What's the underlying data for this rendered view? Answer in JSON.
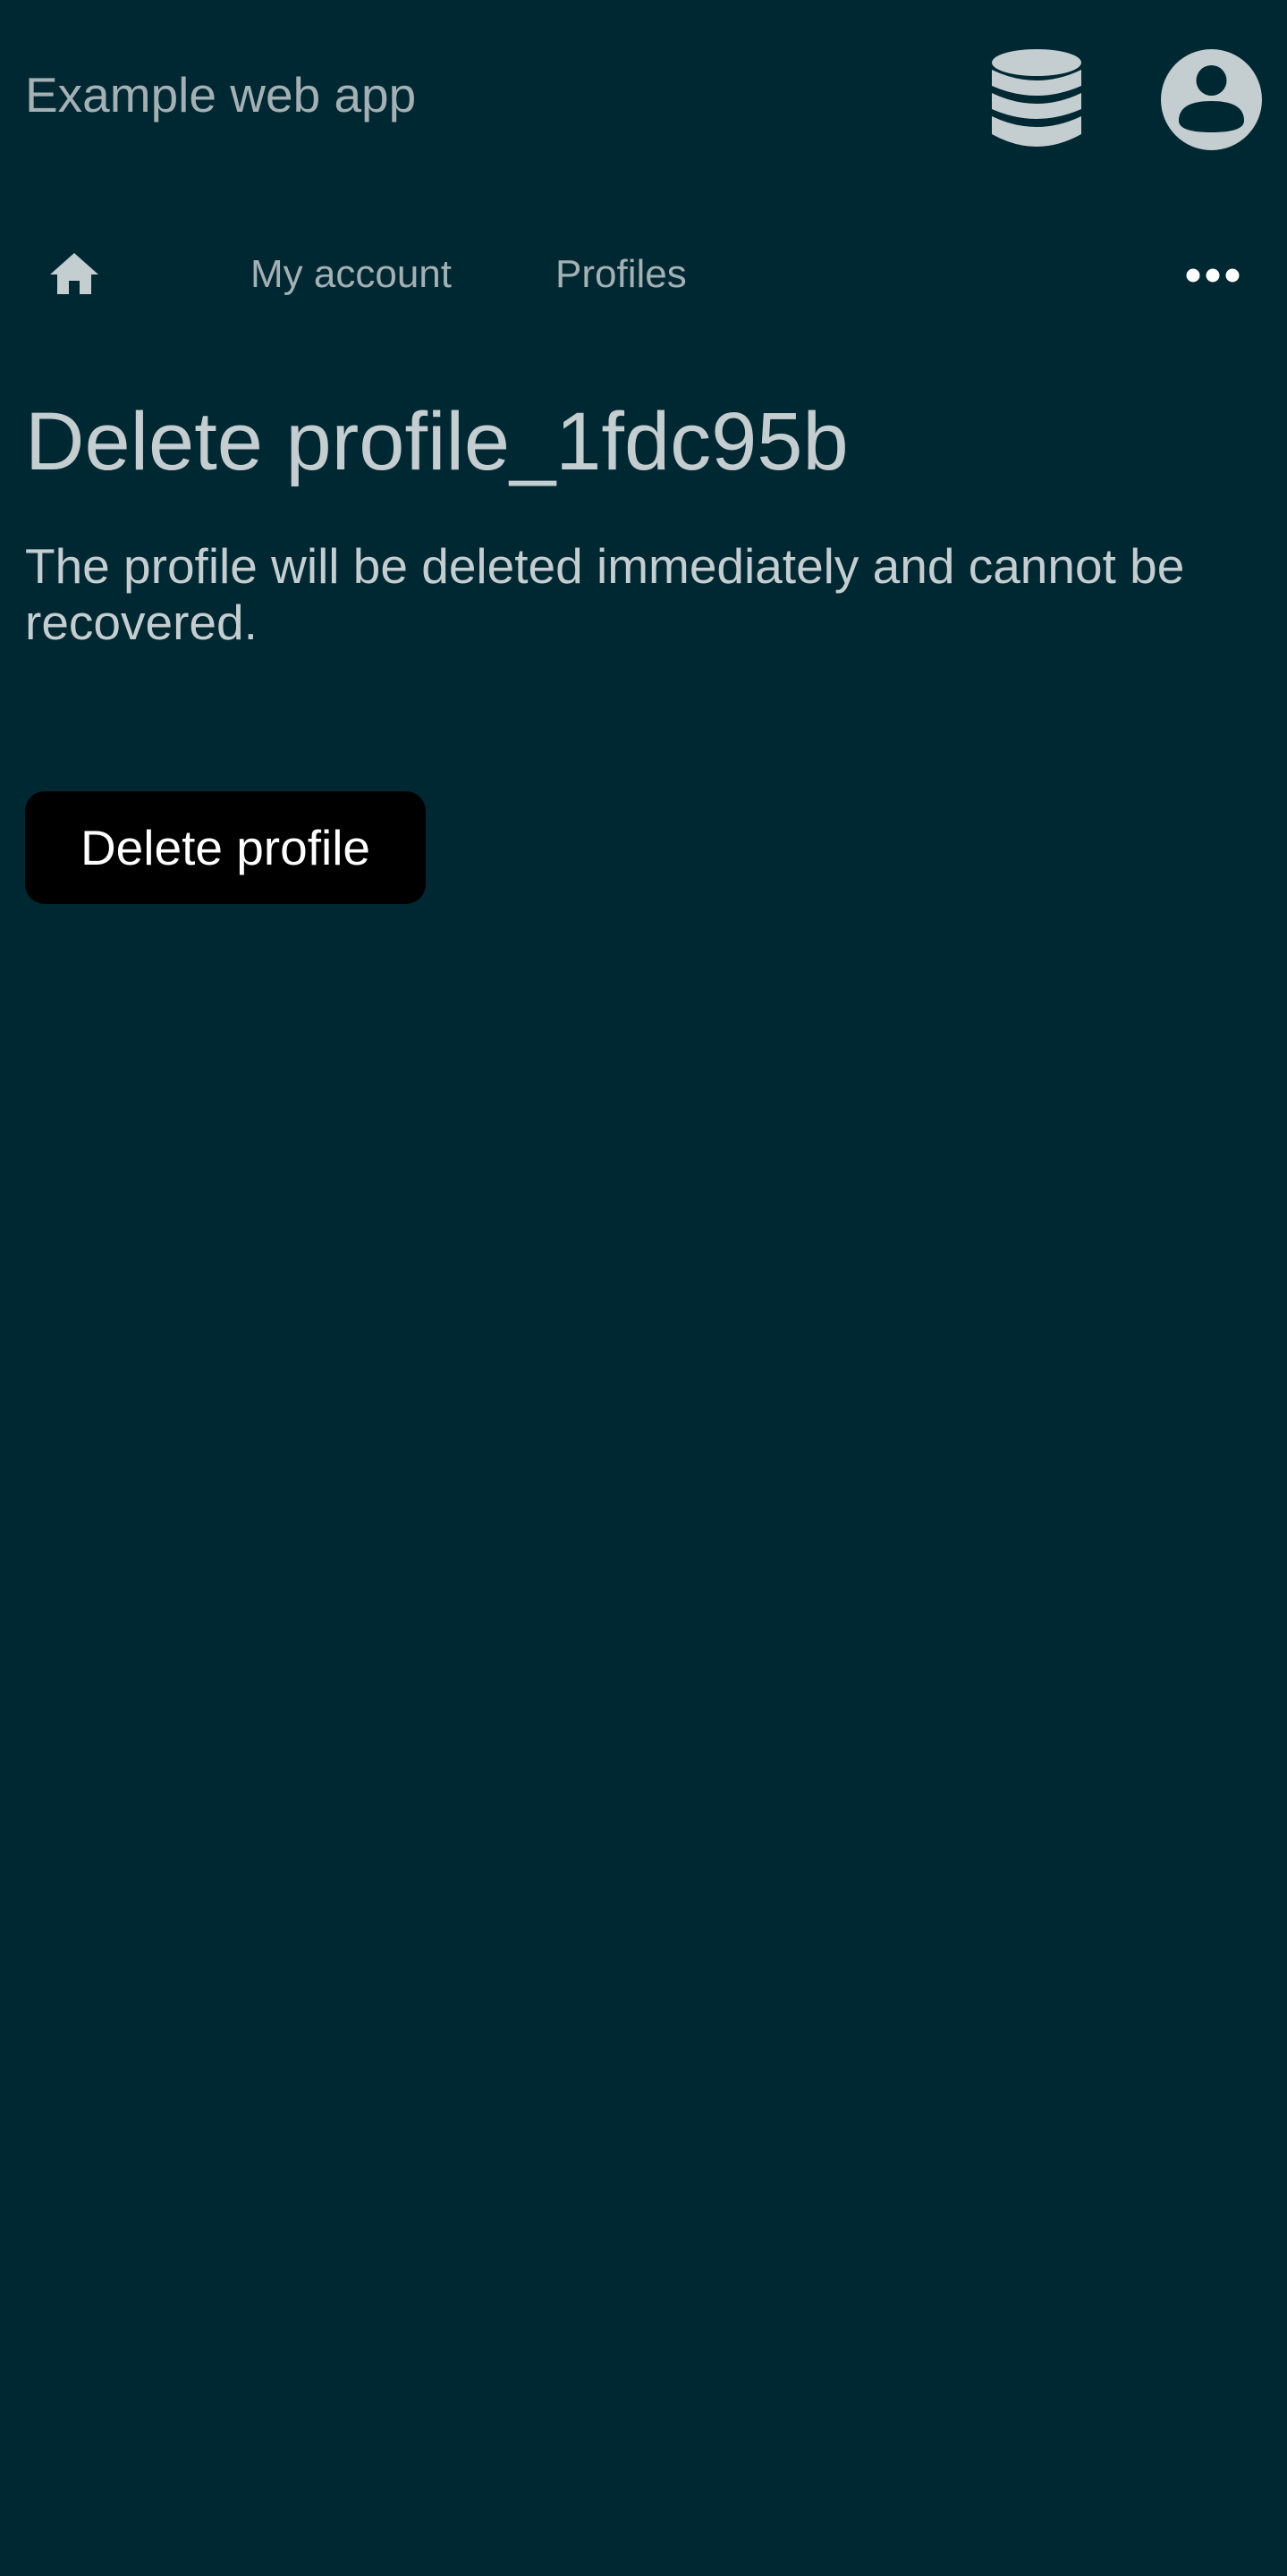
{
  "header": {
    "app_title": "Example web app",
    "database_icon": "database-icon",
    "account_icon": "user-circle-icon"
  },
  "nav": {
    "home_icon": "home-icon",
    "items": [
      {
        "label": "My account"
      },
      {
        "label": "Profiles"
      }
    ],
    "more_icon": "ellipsis-icon"
  },
  "main": {
    "title": "Delete profile_1fdc95b",
    "description": "The profile will be deleted immediately and cannot be recovered.",
    "delete_button_label": "Delete profile"
  },
  "colors": {
    "background": "#002833",
    "text": "#c4cdd0",
    "muted_text": "#a3b0b4",
    "button_bg": "#000000",
    "button_text": "#ffffff"
  }
}
